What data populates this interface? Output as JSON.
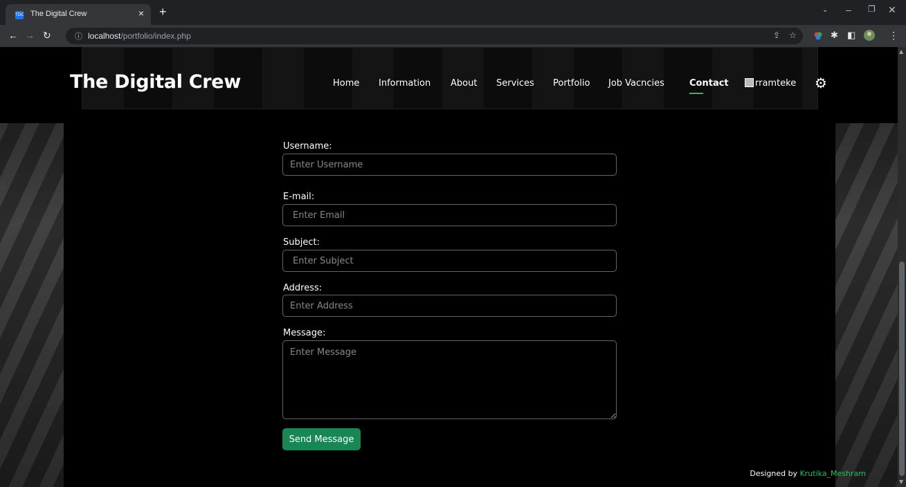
{
  "browser": {
    "tab_title": "The Digital Crew",
    "favicon_text": "TDC",
    "tab_close": "×",
    "new_tab": "+",
    "url_host": "localhost",
    "url_path": "/portfolio/index.php"
  },
  "site": {
    "brand": "The Digital Crew",
    "nav": [
      "Home",
      "Information",
      "About",
      "Services",
      "Portfolio",
      "Job Vacncies",
      "Contact"
    ],
    "active_nav": "Contact",
    "user_name": "rramteke"
  },
  "form": {
    "username_label": "Username:",
    "username_placeholder": "Enter Username",
    "email_label": "E-mail:",
    "email_placeholder": "Enter Email",
    "subject_label": "Subject:",
    "subject_placeholder": "Enter Subject",
    "address_label": "Address:",
    "address_placeholder": "Enter Address",
    "message_label": "Message:",
    "message_placeholder": "Enter Message",
    "submit_label": "Send Message"
  },
  "footer": {
    "designed_by": "Designed by",
    "author": "Krutika_Meshram"
  },
  "colors": {
    "accent": "#198754",
    "nav_underline": "#20c060",
    "page_bg": "#000000"
  }
}
